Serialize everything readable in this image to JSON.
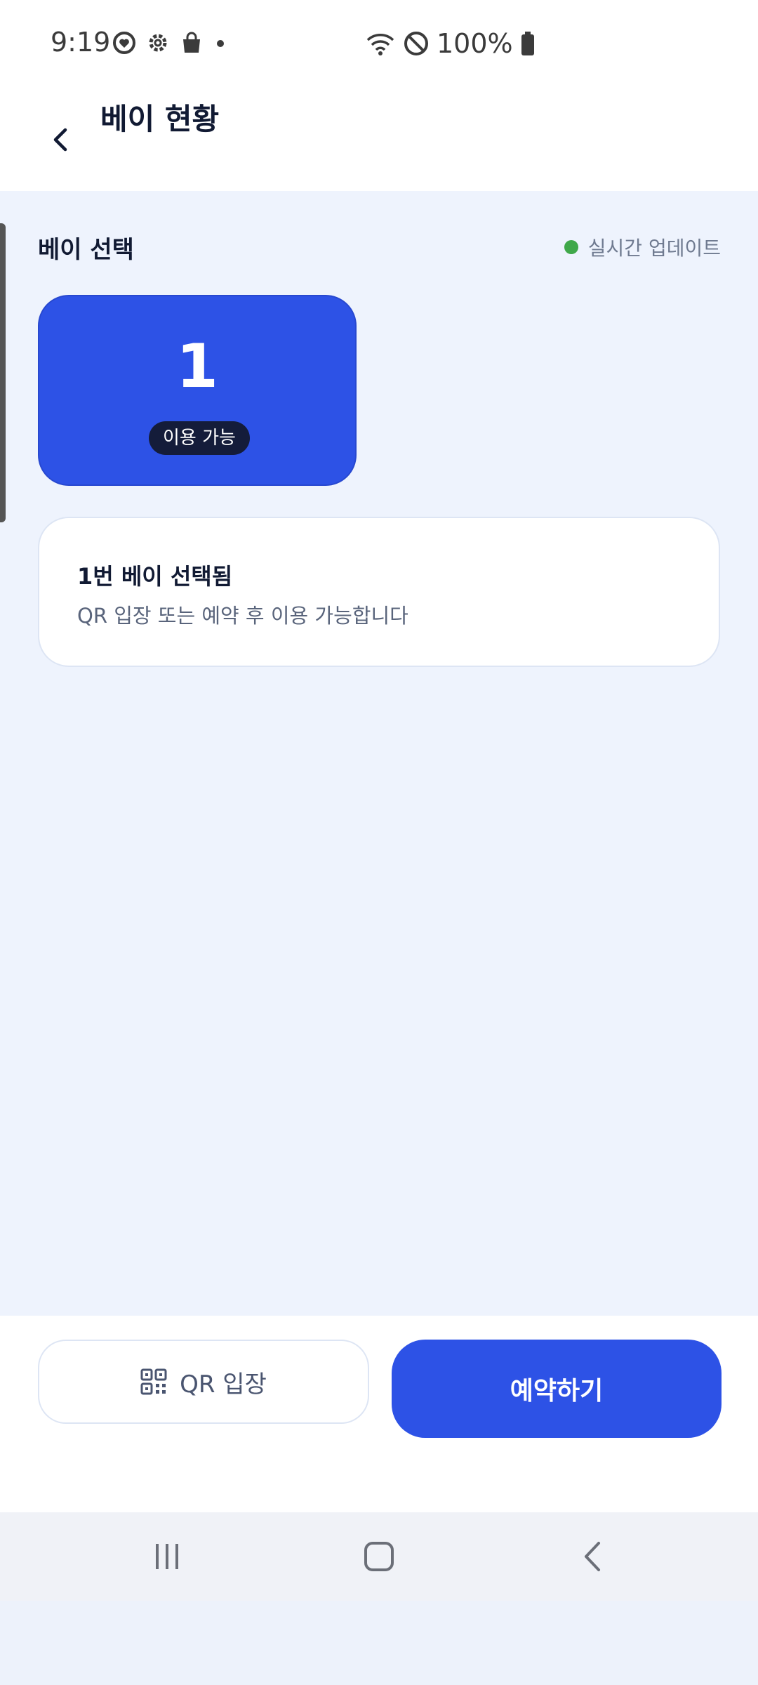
{
  "status_bar": {
    "time": "9:19",
    "battery": "100%"
  },
  "header": {
    "title": "베이 현황"
  },
  "bay_section": {
    "title": "베이 선택",
    "realtime_label": "실시간 업데이트",
    "colors": {
      "accent": "#2d52e6",
      "live": "#3fa84a"
    }
  },
  "bays": [
    {
      "number": "1",
      "status": "이용 가능"
    }
  ],
  "selected_info": {
    "title": "1번 베이 선택됨",
    "description": "QR 입장 또는 예약 후 이용 가능합니다"
  },
  "actions": {
    "qr_label": "QR 입장",
    "reserve_label": "예약하기"
  }
}
